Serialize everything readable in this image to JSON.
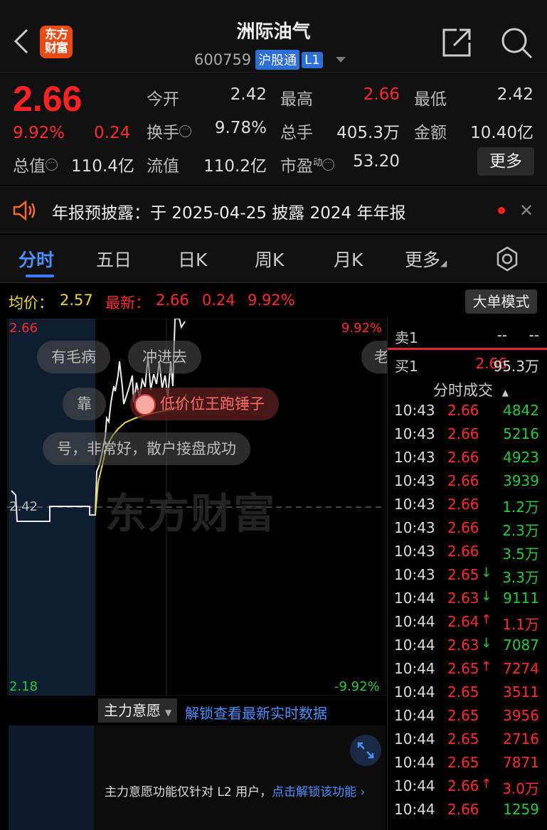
{
  "header": {
    "title": "洲际油气",
    "code": "600759",
    "market_badge": "沪股通",
    "level_badge": "L1",
    "logo_text_line1": "东方",
    "logo_text_line2": "财富"
  },
  "quote": {
    "price": "2.66",
    "change_pct": "9.92%",
    "change_abs": "0.24",
    "total_value_label": "总值",
    "total_value": "110.4亿",
    "open_label": "今开",
    "open": "2.42",
    "high_label": "最高",
    "high": "2.66",
    "low_label": "最低",
    "low": "2.42",
    "turnover_label": "换手",
    "turnover": "9.78%",
    "volume_label": "总手",
    "volume": "405.3万",
    "amount_label": "金额",
    "amount": "10.40亿",
    "float_label": "流值",
    "float_value": "110.2亿",
    "pe_label": "市盈",
    "pe_sup": "动",
    "pe": "53.20",
    "more_button": "更多"
  },
  "notice": {
    "text": "年报预披露：于 2025-04-25 披露 2024 年年报"
  },
  "tabs": [
    {
      "label": "分时",
      "active": true
    },
    {
      "label": "五日"
    },
    {
      "label": "日K"
    },
    {
      "label": "周K"
    },
    {
      "label": "月K"
    },
    {
      "label": "更多"
    }
  ],
  "chart_info": {
    "avg_label": "均价：",
    "avg_value": "2.57",
    "latest_label": "最新：",
    "latest_value": "2.66",
    "latest_change": "0.24",
    "latest_pct": "9.92%",
    "bigorder_button": "大单模式"
  },
  "chart_axes": {
    "top_price": "2.66",
    "top_pct": "9.92%",
    "mid_price": "2.42",
    "bottom_price": "2.18",
    "bottom_pct": "-9.92%"
  },
  "danmaku": [
    "有毛病",
    "冲进去",
    "老",
    "靠",
    "低价位王跑锤子",
    "号，非常好，散户接盘成功"
  ],
  "watermark": "东方财富",
  "zhuli": {
    "selector": "主力意愿",
    "unlock_link": "解锁查看最新实时数据",
    "lower_msg": "主力意愿功能仅针对 L2 用户，",
    "lower_link": "点击解锁该功能"
  },
  "order_book": {
    "sell1_label": "卖1",
    "sell1_price": "--",
    "sell1_vol": "--",
    "buy1_label": "买1",
    "buy1_price": "2.66",
    "buy1_vol": "95.3万",
    "trades_title": "分时成交"
  },
  "trades": [
    {
      "time": "10:43",
      "price": "2.66",
      "arrow": "",
      "vol": "4842",
      "dir": "down"
    },
    {
      "time": "10:43",
      "price": "2.66",
      "arrow": "",
      "vol": "5216",
      "dir": "down"
    },
    {
      "time": "10:43",
      "price": "2.66",
      "arrow": "",
      "vol": "4923",
      "dir": "down"
    },
    {
      "time": "10:43",
      "price": "2.66",
      "arrow": "",
      "vol": "3939",
      "dir": "down"
    },
    {
      "time": "10:43",
      "price": "2.66",
      "arrow": "",
      "vol": "1.2万",
      "dir": "down"
    },
    {
      "time": "10:43",
      "price": "2.66",
      "arrow": "",
      "vol": "2.3万",
      "dir": "down"
    },
    {
      "time": "10:43",
      "price": "2.66",
      "arrow": "",
      "vol": "3.5万",
      "dir": "down"
    },
    {
      "time": "10:43",
      "price": "2.65",
      "arrow": "↓",
      "vol": "3.3万",
      "dir": "down"
    },
    {
      "time": "10:44",
      "price": "2.63",
      "arrow": "↓",
      "vol": "9111",
      "dir": "down"
    },
    {
      "time": "10:44",
      "price": "2.64",
      "arrow": "↑",
      "vol": "1.1万",
      "dir": "up"
    },
    {
      "time": "10:44",
      "price": "2.63",
      "arrow": "↓",
      "vol": "7087",
      "dir": "down"
    },
    {
      "time": "10:44",
      "price": "2.65",
      "arrow": "↑",
      "vol": "7274",
      "dir": "up"
    },
    {
      "time": "10:44",
      "price": "2.65",
      "arrow": "",
      "vol": "3511",
      "dir": "up"
    },
    {
      "time": "10:44",
      "price": "2.65",
      "arrow": "",
      "vol": "3956",
      "dir": "up"
    },
    {
      "time": "10:44",
      "price": "2.65",
      "arrow": "",
      "vol": "2716",
      "dir": "up"
    },
    {
      "time": "10:44",
      "price": "2.65",
      "arrow": "",
      "vol": "7871",
      "dir": "up"
    },
    {
      "time": "10:44",
      "price": "2.66",
      "arrow": "↑",
      "vol": "3.0万",
      "dir": "up"
    },
    {
      "time": "10:44",
      "price": "2.66",
      "arrow": "",
      "vol": "1259",
      "dir": "down"
    }
  ],
  "colors": {
    "up": "#ff2a2a",
    "down": "#22c93a",
    "avg_line": "#e8d63c",
    "accent": "#3b7fff"
  }
}
